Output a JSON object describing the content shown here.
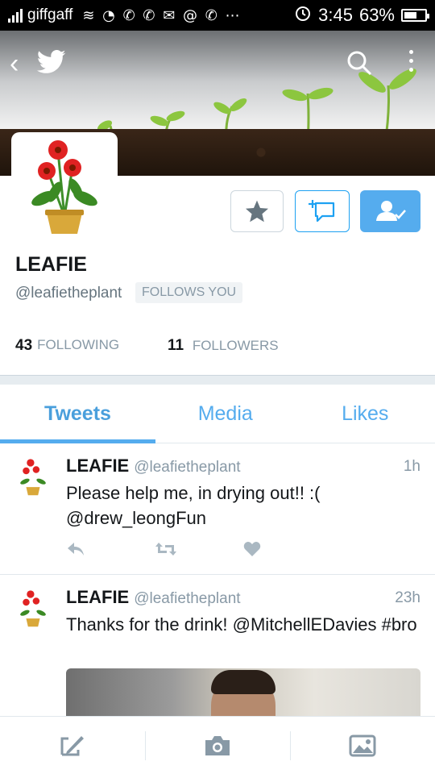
{
  "status_bar": {
    "carrier": "giffgaff",
    "icons": "≋ ◔ ✆ ✆ ✉ @ ✆ ⋯",
    "time": "3:45",
    "battery": "63%",
    "battery_level": 0.63
  },
  "profile": {
    "name": "LEAFIE",
    "handle": "@leafietheplant",
    "follows_you": "FOLLOWS YOU",
    "following_count": "43",
    "following_label": "FOLLOWING",
    "followers_count": "11",
    "followers_label": "FOLLOWERS"
  },
  "tabs": [
    {
      "label": "Tweets",
      "active": true
    },
    {
      "label": "Media",
      "active": false
    },
    {
      "label": "Likes",
      "active": false
    }
  ],
  "tweets": [
    {
      "name": "LEAFIE",
      "handle": "@leafietheplant",
      "time": "1h",
      "text": "Please help me, in drying out!! :( @drew_leongFun"
    },
    {
      "name": "LEAFIE",
      "handle": "@leafietheplant",
      "time": "23h",
      "text": "Thanks for the drink! @MitchellEDavies #bro"
    }
  ],
  "colors": {
    "accent": "#55acee",
    "text_secondary": "#8899a6"
  },
  "icons": {
    "back": "back-icon",
    "bird": "twitter-bird-icon",
    "search": "search-icon",
    "more": "more-vertical-icon",
    "star": "star-icon",
    "dm": "add-message-icon",
    "following": "following-user-icon",
    "reply": "reply-icon",
    "retweet": "retweet-icon",
    "like": "heart-icon",
    "compose": "compose-icon",
    "camera": "camera-icon",
    "gallery": "gallery-icon"
  }
}
